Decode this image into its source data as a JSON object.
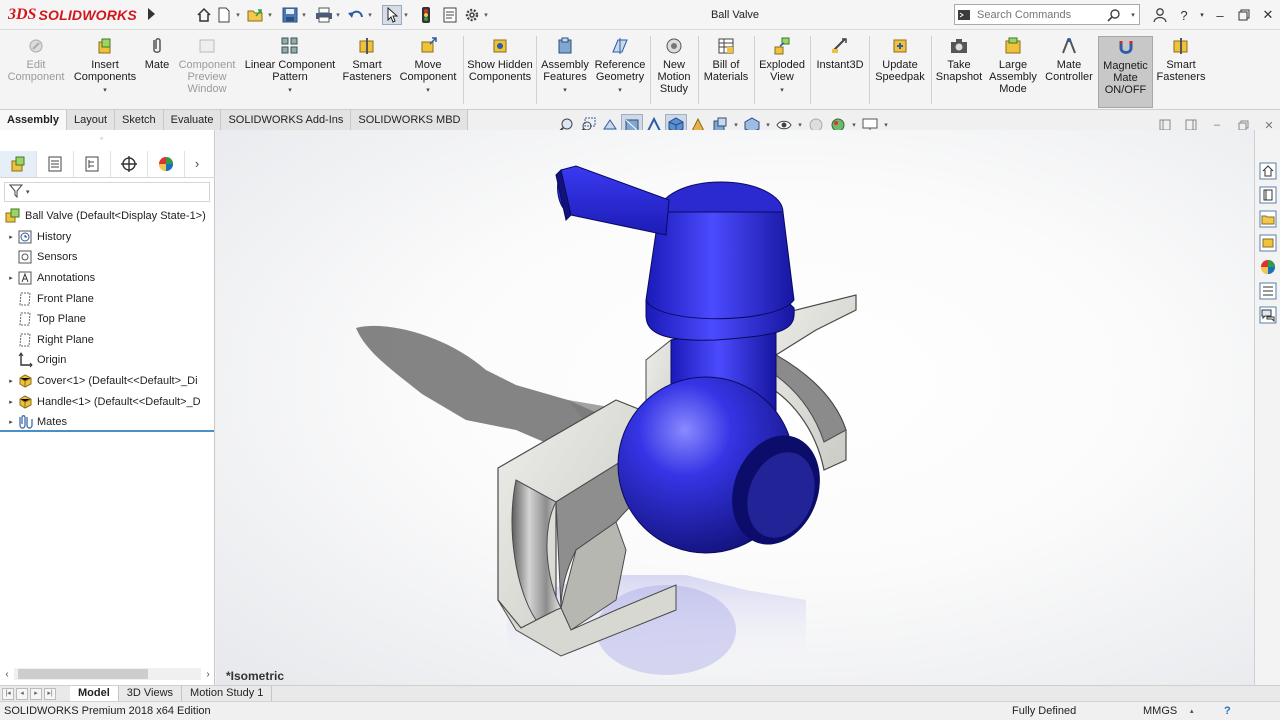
{
  "app": {
    "logo_prefix": "3DS",
    "logo_text": "SOLIDWORKS",
    "document_title": "Ball Valve"
  },
  "search": {
    "placeholder": "Search Commands"
  },
  "ribbon": {
    "buttons": [
      {
        "label": "Edit Component",
        "icon": "edit-component-icon",
        "disabled": true
      },
      {
        "label": "Insert Components",
        "icon": "insert-components-icon"
      },
      {
        "label": "Mate",
        "icon": "paperclip-icon"
      },
      {
        "label": "Component Preview Window",
        "icon": "preview-window-icon",
        "disabled": true
      },
      {
        "label": "Linear Component Pattern",
        "icon": "linear-pattern-icon"
      },
      {
        "label": "Smart Fasteners",
        "icon": "smart-fasteners-icon"
      },
      {
        "label": "Move Component",
        "icon": "move-component-icon"
      },
      {
        "label": "Show Hidden Components",
        "icon": "show-hidden-icon"
      },
      {
        "label": "Assembly Features",
        "icon": "assembly-features-icon"
      },
      {
        "label": "Reference Geometry",
        "icon": "reference-geometry-icon"
      },
      {
        "label": "New Motion Study",
        "icon": "motion-study-icon"
      },
      {
        "label": "Bill of Materials",
        "icon": "bill-of-materials-icon"
      },
      {
        "label": "Exploded View",
        "icon": "exploded-view-icon"
      },
      {
        "label": "Instant3D",
        "icon": "instant3d-icon"
      },
      {
        "label": "Update Speedpak",
        "icon": "speedpak-icon"
      },
      {
        "label": "Take Snapshot",
        "icon": "camera-icon"
      },
      {
        "label": "Large Assembly Mode",
        "icon": "large-assembly-icon"
      },
      {
        "label": "Mate Controller",
        "icon": "mate-controller-icon"
      },
      {
        "label": "Magnetic Mate ON/OFF",
        "icon": "magnet-icon",
        "active": true
      },
      {
        "label": "Smart Fasteners",
        "icon": "smart-fasteners-icon"
      }
    ]
  },
  "cm_tabs": [
    "Assembly",
    "Layout",
    "Sketch",
    "Evaluate",
    "SOLIDWORKS Add-Ins",
    "SOLIDWORKS MBD"
  ],
  "feature_tree": {
    "root": "Ball Valve  (Default<Display State-1>)",
    "items": [
      {
        "label": "History",
        "icon": "history-icon",
        "expandable": true
      },
      {
        "label": "Sensors",
        "icon": "sensors-icon",
        "expandable": false
      },
      {
        "label": "Annotations",
        "icon": "annotations-icon",
        "expandable": true
      },
      {
        "label": "Front Plane",
        "icon": "plane-icon",
        "expandable": false
      },
      {
        "label": "Top Plane",
        "icon": "plane-icon",
        "expandable": false
      },
      {
        "label": "Right Plane",
        "icon": "plane-icon",
        "expandable": false
      },
      {
        "label": "Origin",
        "icon": "origin-icon",
        "expandable": false
      },
      {
        "label": "Cover<1> (Default<<Default>_Di",
        "icon": "part-icon",
        "expandable": true
      },
      {
        "label": "Handle<1> (Default<<Default>_D",
        "icon": "part-icon",
        "expandable": true
      },
      {
        "label": "Mates",
        "icon": "mates-icon",
        "expandable": true
      }
    ]
  },
  "viewport": {
    "view_label": "*Isometric"
  },
  "bottom_tabs": [
    "Model",
    "3D Views",
    "Motion Study 1"
  ],
  "status": {
    "edition": "SOLIDWORKS Premium 2018 x64 Edition",
    "state": "Fully Defined",
    "units": "MMGS",
    "help": "?"
  },
  "colors": {
    "brand_red": "#d2161e",
    "part_blue": "#2a2ad0",
    "metal_gray": "#b9b9b9",
    "selection_blue": "#4a90c8"
  }
}
